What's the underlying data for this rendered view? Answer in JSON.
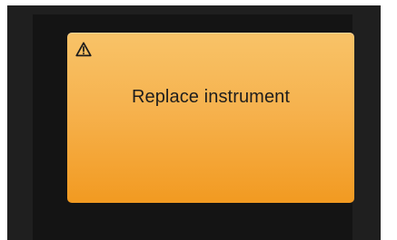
{
  "alert": {
    "icon": "warning-triangle-icon",
    "message": "Replace instrument",
    "panel_color_top": "#f8c368",
    "panel_color_bottom": "#f29a21"
  }
}
